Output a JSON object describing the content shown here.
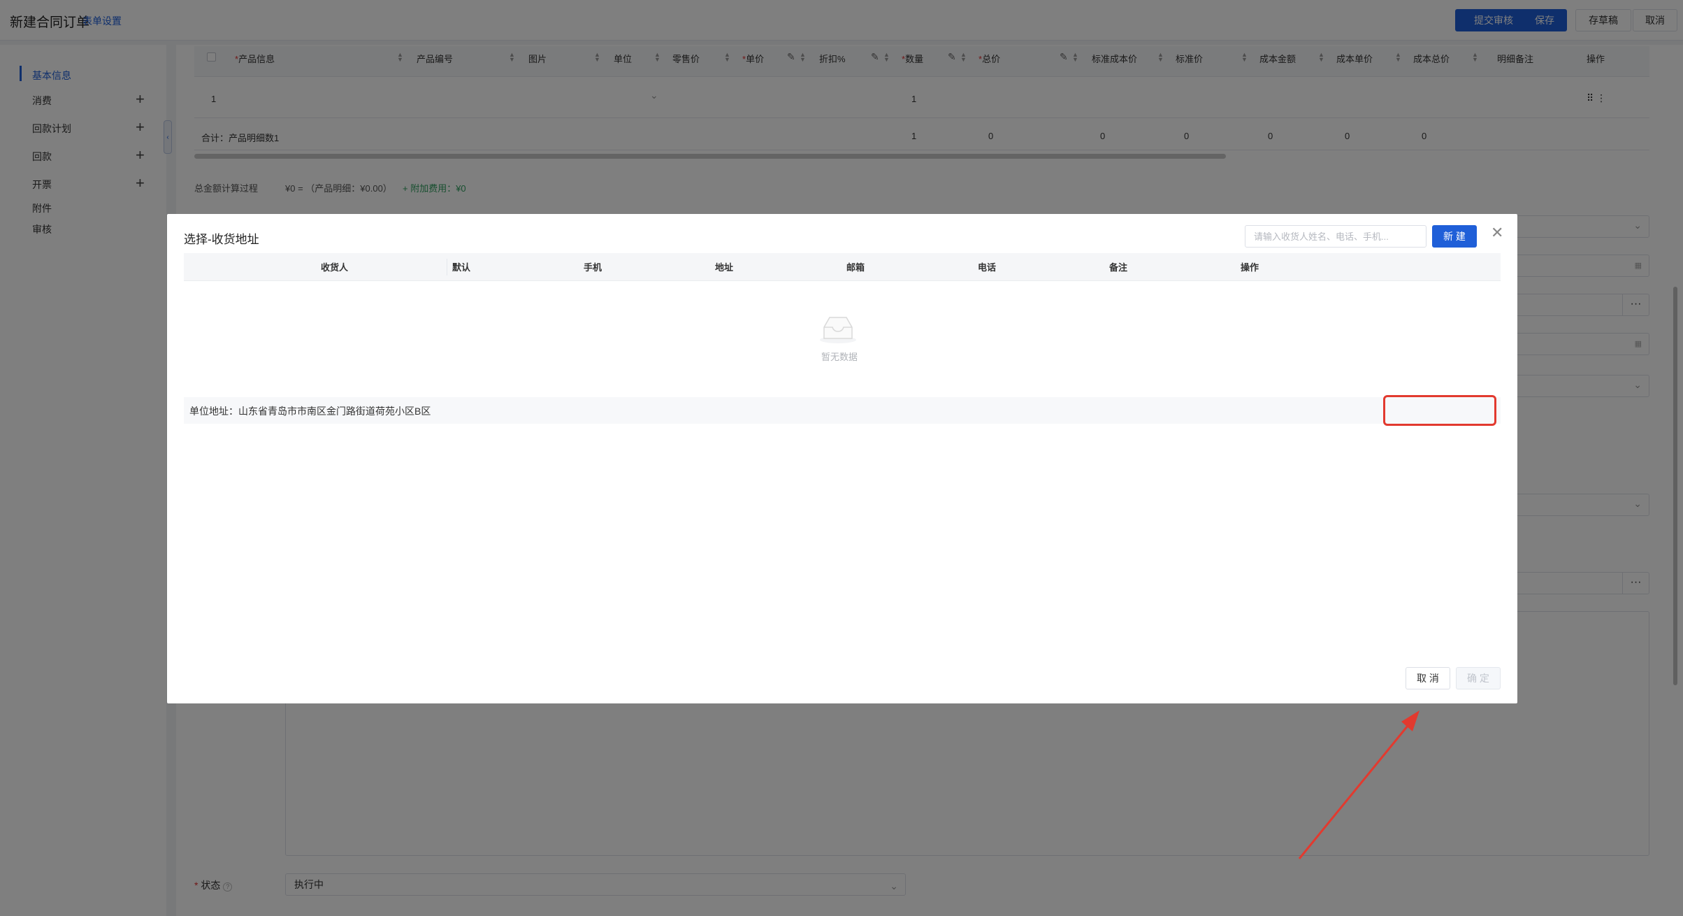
{
  "header": {
    "title": "新建合同订单",
    "form_settings": "表单设置",
    "btn_submit_review": "提交审核",
    "btn_save": "保存",
    "btn_draft": "存草稿",
    "btn_cancel": "取消"
  },
  "nav": {
    "items": [
      {
        "label": "基本信息",
        "active": true,
        "plus": false
      },
      {
        "label": "消费",
        "active": false,
        "plus": true
      },
      {
        "label": "回款计划",
        "active": false,
        "plus": true
      },
      {
        "label": "回款",
        "active": false,
        "plus": true
      },
      {
        "label": "开票",
        "active": false,
        "plus": true
      },
      {
        "label": "附件",
        "active": false,
        "plus": false
      },
      {
        "label": "审核",
        "active": false,
        "plus": false
      }
    ]
  },
  "product_table": {
    "columns": {
      "product_info": "产品信息",
      "product_code": "产品编号",
      "image": "图片",
      "unit": "单位",
      "retail_price": "零售价",
      "unit_price": "单价",
      "discount": "折扣%",
      "quantity": "数量",
      "total_price": "总价",
      "std_cost_price": "标准成本价",
      "std_price": "标准价",
      "cost_amount": "成本金额",
      "cost_unit_price": "成本单价",
      "cost_total": "成本总价",
      "detail_note": "明细备注",
      "action": "操作"
    },
    "row1": {
      "index": "1",
      "quantity": "1",
      "action": "⠿ ⋮"
    },
    "summary": {
      "label": "合计：产品明细数1",
      "quantity": "1",
      "total": "0",
      "std_cost": "0",
      "std_price": "0",
      "cost_amount": "0",
      "cost_unit": "0",
      "cost_total": "0"
    }
  },
  "calc": {
    "label": "总金额计算过程",
    "value": "¥0 = （产品明细：¥0.00）",
    "extra": "+ 附加费用：¥0"
  },
  "status": {
    "label": "状态",
    "value": "执行中"
  },
  "modal": {
    "title": "选择-收货地址",
    "search_placeholder": "请输入收货人姓名、电话、手机...",
    "new_button": "新 建",
    "columns": [
      "收货人",
      "默认",
      "手机",
      "地址",
      "邮箱",
      "电话",
      "备注",
      "操作"
    ],
    "empty_text": "暂无数据",
    "unit_address": "单位地址：山东省青岛市市南区金门路街道荷苑小区B区",
    "cancel": "取 消",
    "confirm": "确 定"
  }
}
